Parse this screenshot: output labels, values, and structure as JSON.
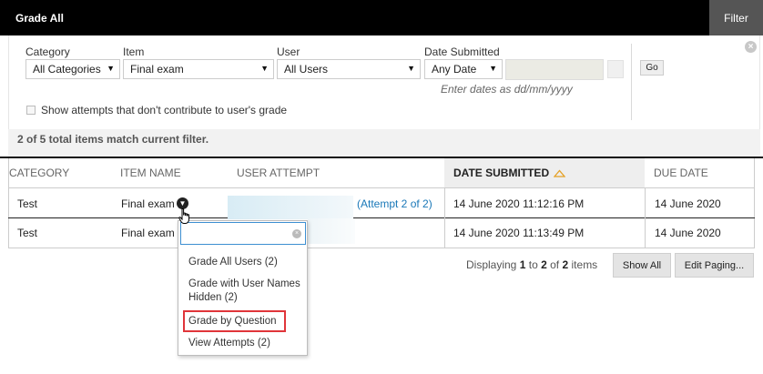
{
  "header": {
    "title": "Grade All",
    "filter_tab": "Filter"
  },
  "filters": {
    "category": {
      "label": "Category",
      "value": "All Categories"
    },
    "item": {
      "label": "Item",
      "value": "Final exam"
    },
    "user": {
      "label": "User",
      "value": "All Users"
    },
    "date": {
      "label": "Date Submitted",
      "value": "Any Date",
      "hint": "Enter dates as dd/mm/yyyy"
    },
    "go_label": "Go",
    "show_attempts_label": "Show attempts that don't contribute to user's grade"
  },
  "match_text": "2 of 5 total items match current filter.",
  "table": {
    "headers": [
      "CATEGORY",
      "ITEM NAME",
      "USER ATTEMPT",
      "DATE SUBMITTED",
      "DUE DATE"
    ],
    "rows": [
      {
        "category": "Test",
        "item": "Final exam",
        "attempt": "(Attempt 2 of 2)",
        "date": "14 June 2020 11:12:16 PM",
        "due": "14 June 2020"
      },
      {
        "category": "Test",
        "item": "Final exam",
        "attempt": "",
        "date": "14 June 2020 11:13:49 PM",
        "due": "14 June 2020"
      }
    ]
  },
  "menu": {
    "items": [
      "Grade All Users (2)",
      "Grade with User Names Hidden (2)",
      "Grade by Question",
      "View Attempts (2)"
    ]
  },
  "pagination": {
    "prefix": "Displaying",
    "from": "1",
    "to_word": "to",
    "to": "2",
    "of_word": "of",
    "total": "2",
    "suffix": "items",
    "show_all": "Show All",
    "edit_paging": "Edit Paging..."
  },
  "colors": {
    "header_bg": "#000000",
    "link": "#1a78b8",
    "highlight": "#e0353a"
  }
}
